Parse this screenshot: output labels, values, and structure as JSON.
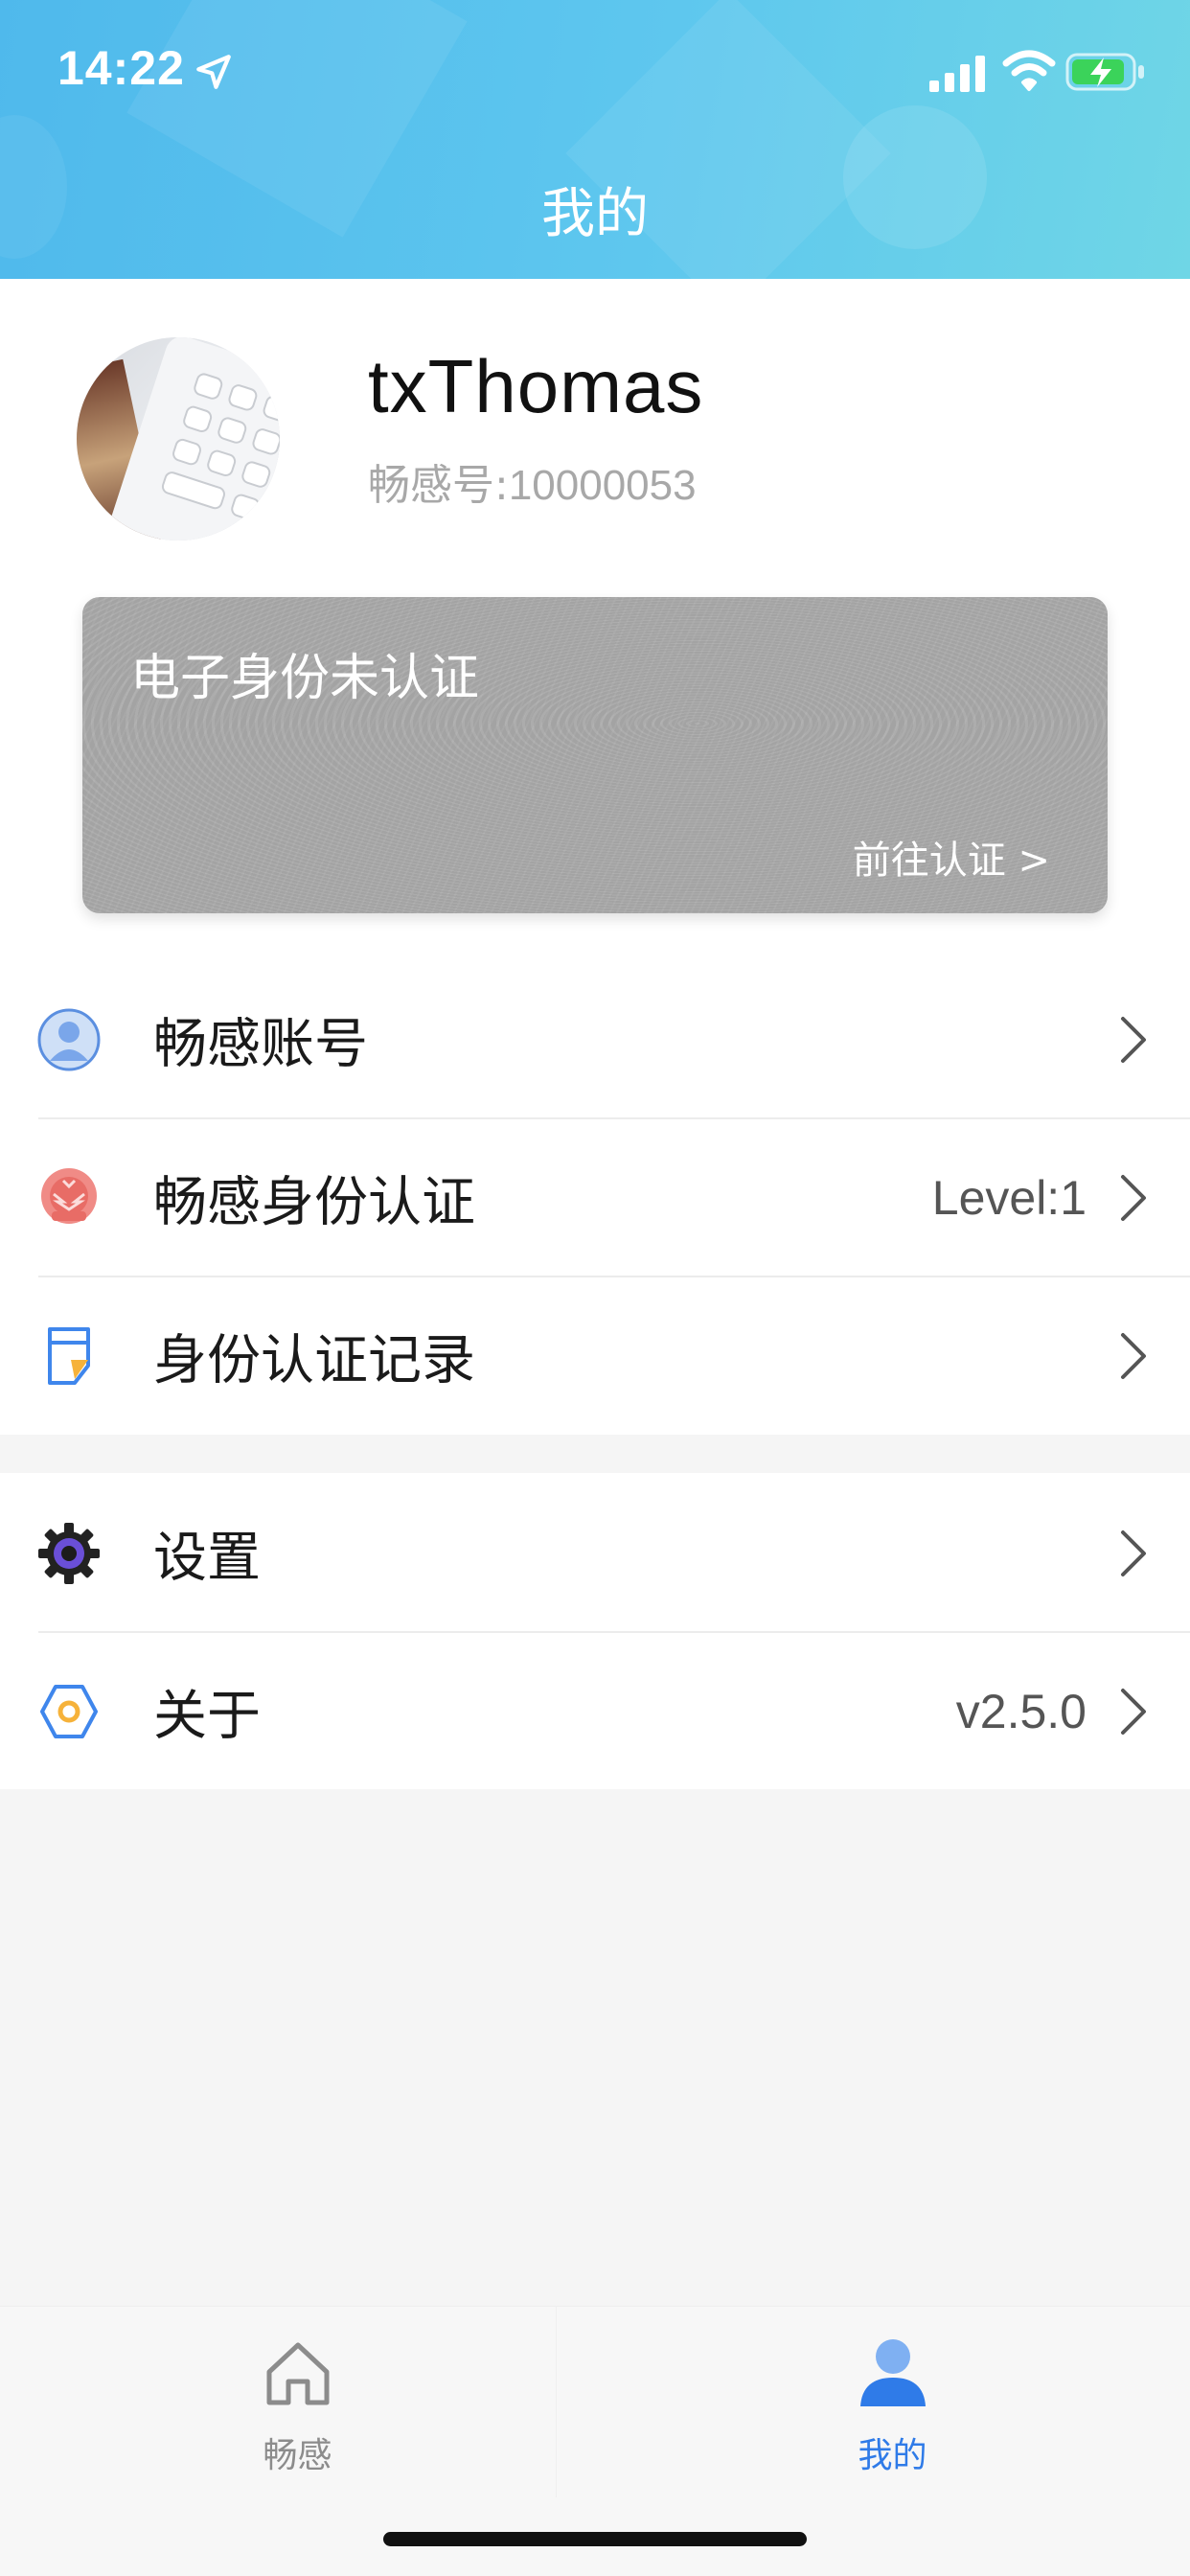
{
  "status_bar": {
    "time": "14:22",
    "icons": [
      "location-arrow-icon",
      "cell-signal-icon",
      "wifi-icon",
      "battery-charging-icon"
    ],
    "battery_color": "#3bd35a"
  },
  "header": {
    "title": "我的",
    "background_colors": [
      "#4fb9ec",
      "#6fd6e6"
    ]
  },
  "profile": {
    "username": "txThomas",
    "id_label": "畅感号:",
    "id_value": "10000053"
  },
  "id_card": {
    "title": "电子身份未认证",
    "link": "前往认证 >",
    "background_color": "#a3a3a3"
  },
  "menu_group_1": [
    {
      "icon": "user-avatar-icon",
      "label": "畅感账号",
      "value": ""
    },
    {
      "icon": "national-emblem-icon",
      "label": "畅感身份认证",
      "value": "Level:1"
    },
    {
      "icon": "document-record-icon",
      "label": "身份认证记录",
      "value": ""
    }
  ],
  "menu_group_2": [
    {
      "icon": "gear-icon",
      "label": "设置",
      "value": ""
    },
    {
      "icon": "hexagon-about-icon",
      "label": "关于",
      "value": "v2.5.0"
    }
  ],
  "tab_bar": {
    "tabs": [
      {
        "icon": "home-icon",
        "label": "畅感",
        "active": false
      },
      {
        "icon": "person-icon",
        "label": "我的",
        "active": true
      }
    ],
    "active_color": "#2f7be8",
    "inactive_color": "#8c8c8c"
  }
}
